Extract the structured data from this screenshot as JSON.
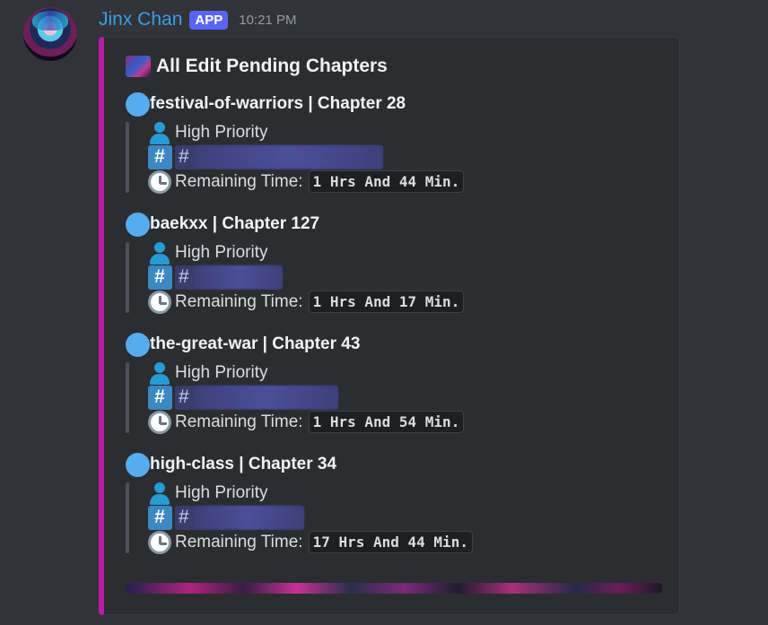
{
  "message": {
    "username": "Jinx Chan",
    "app_tag": "APP",
    "timestamp": "10:21 PM"
  },
  "embed": {
    "title": "All Edit Pending Chapters",
    "accent_color": "#bd1aa8",
    "chapters": [
      {
        "name": "festival-of-warriors | Chapter 28",
        "priority": "High Priority",
        "channel_prefix": "#",
        "time_label": "Remaining Time:",
        "remaining": "1 Hrs And 44 Min."
      },
      {
        "name": "baekxx | Chapter 127",
        "priority": "High Priority",
        "channel_prefix": "#",
        "time_label": "Remaining Time:",
        "remaining": "1 Hrs And 17 Min."
      },
      {
        "name": "the-great-war | Chapter 43",
        "priority": "High Priority",
        "channel_prefix": "#",
        "time_label": "Remaining Time:",
        "remaining": "1 Hrs And 54 Min."
      },
      {
        "name": "high-class | Chapter 34",
        "priority": "High Priority",
        "channel_prefix": "#",
        "time_label": "Remaining Time:",
        "remaining": "17 Hrs And 44 Min."
      }
    ]
  },
  "icons": {
    "dot": "blue-circle-icon",
    "priority": "bust-silhouette-icon",
    "channel": "hash-keycap-icon",
    "time": "clock-icon"
  }
}
